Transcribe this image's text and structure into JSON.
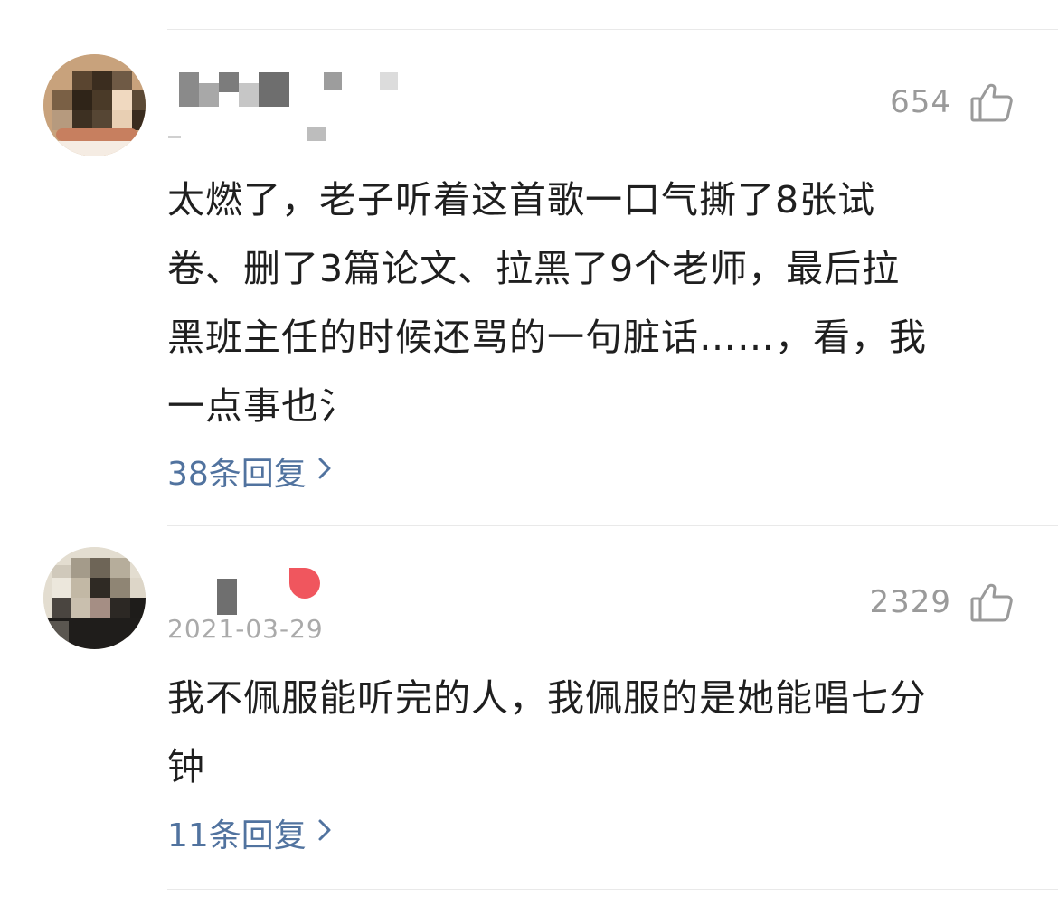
{
  "comments": [
    {
      "likes": "654",
      "text_lines": [
        "太燃了，老子听着这首歌一口气撕了8张试",
        "卷、删了3篇论文、拉黑了9个老师，最后拉",
        "黑班主任的时候还骂的一句脏话……，看，我",
        "一点事也氵"
      ],
      "replies_label": "38条回复",
      "like_icon": "thumbs-up-icon",
      "chevron_icon": "chevron-right-icon"
    },
    {
      "likes": "2329",
      "date": "2021-03-29",
      "text_lines": [
        "我不佩服能听完的人，我佩服的是她能唱七分",
        "钟"
      ],
      "replies_label": "11条回复",
      "like_icon": "thumbs-up-icon",
      "chevron_icon": "chevron-right-icon"
    }
  ],
  "colors": {
    "link": "#51739f",
    "meta": "#9a9a9a",
    "divider": "#e9e9e9",
    "badge": "#f0565e"
  }
}
